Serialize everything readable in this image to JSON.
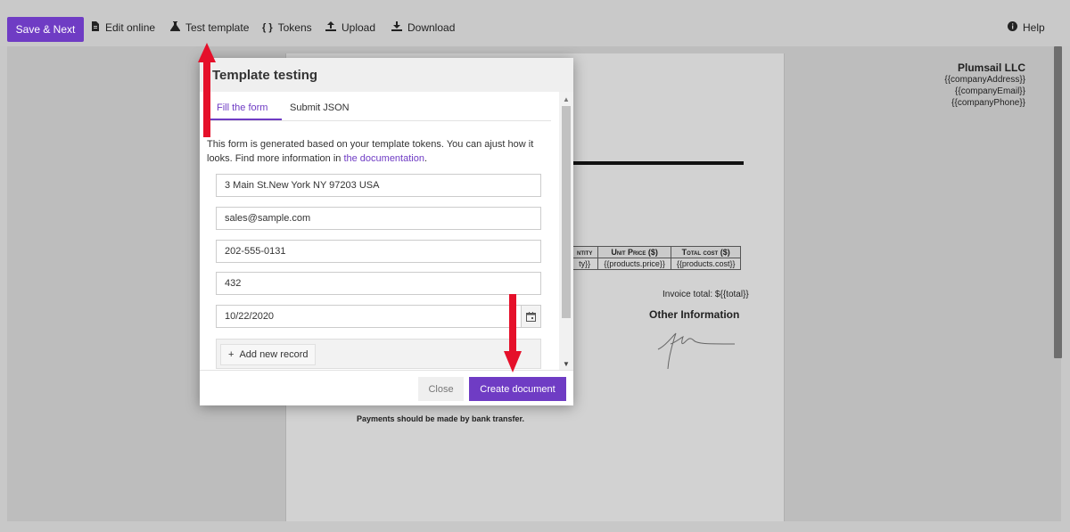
{
  "toolbar": {
    "save_next": "Save & Next",
    "edit_online": "Edit online",
    "test_template": "Test template",
    "tokens": "Tokens",
    "upload": "Upload",
    "download": "Download",
    "help": "Help"
  },
  "document": {
    "company_name": "Plumsail LLC",
    "company_address": "{{companyAddress}}",
    "company_email": "{{companyEmail}}",
    "company_phone": "{{companyPhone}}",
    "table_headers": [
      "ntity",
      "Unit Price ($)",
      "Total cost ($)"
    ],
    "table_row": [
      "ty}}",
      "{{products.price}}",
      "{{products.cost}}"
    ],
    "invoice_total": "Invoice total: ${{total}}",
    "other_info": "Other Information",
    "payments": "Payments should be made by bank transfer."
  },
  "modal": {
    "title": "Template testing",
    "tab_fill": "Fill the form",
    "tab_submit": "Submit JSON",
    "desc_text": "This form is generated based on your template tokens. You can ajust how it looks. Find more information in ",
    "desc_link": "the documentation",
    "desc_end": ".",
    "fields": {
      "address": "3 Main St.New York NY 97203 USA",
      "email": "sales@sample.com",
      "phone": "202-555-0131",
      "number": "432",
      "date": "10/22/2020"
    },
    "add_record": "Add new record",
    "close": "Close",
    "create": "Create document"
  },
  "colors": {
    "accent": "#6f3cc4",
    "arrow": "#e5102a"
  }
}
